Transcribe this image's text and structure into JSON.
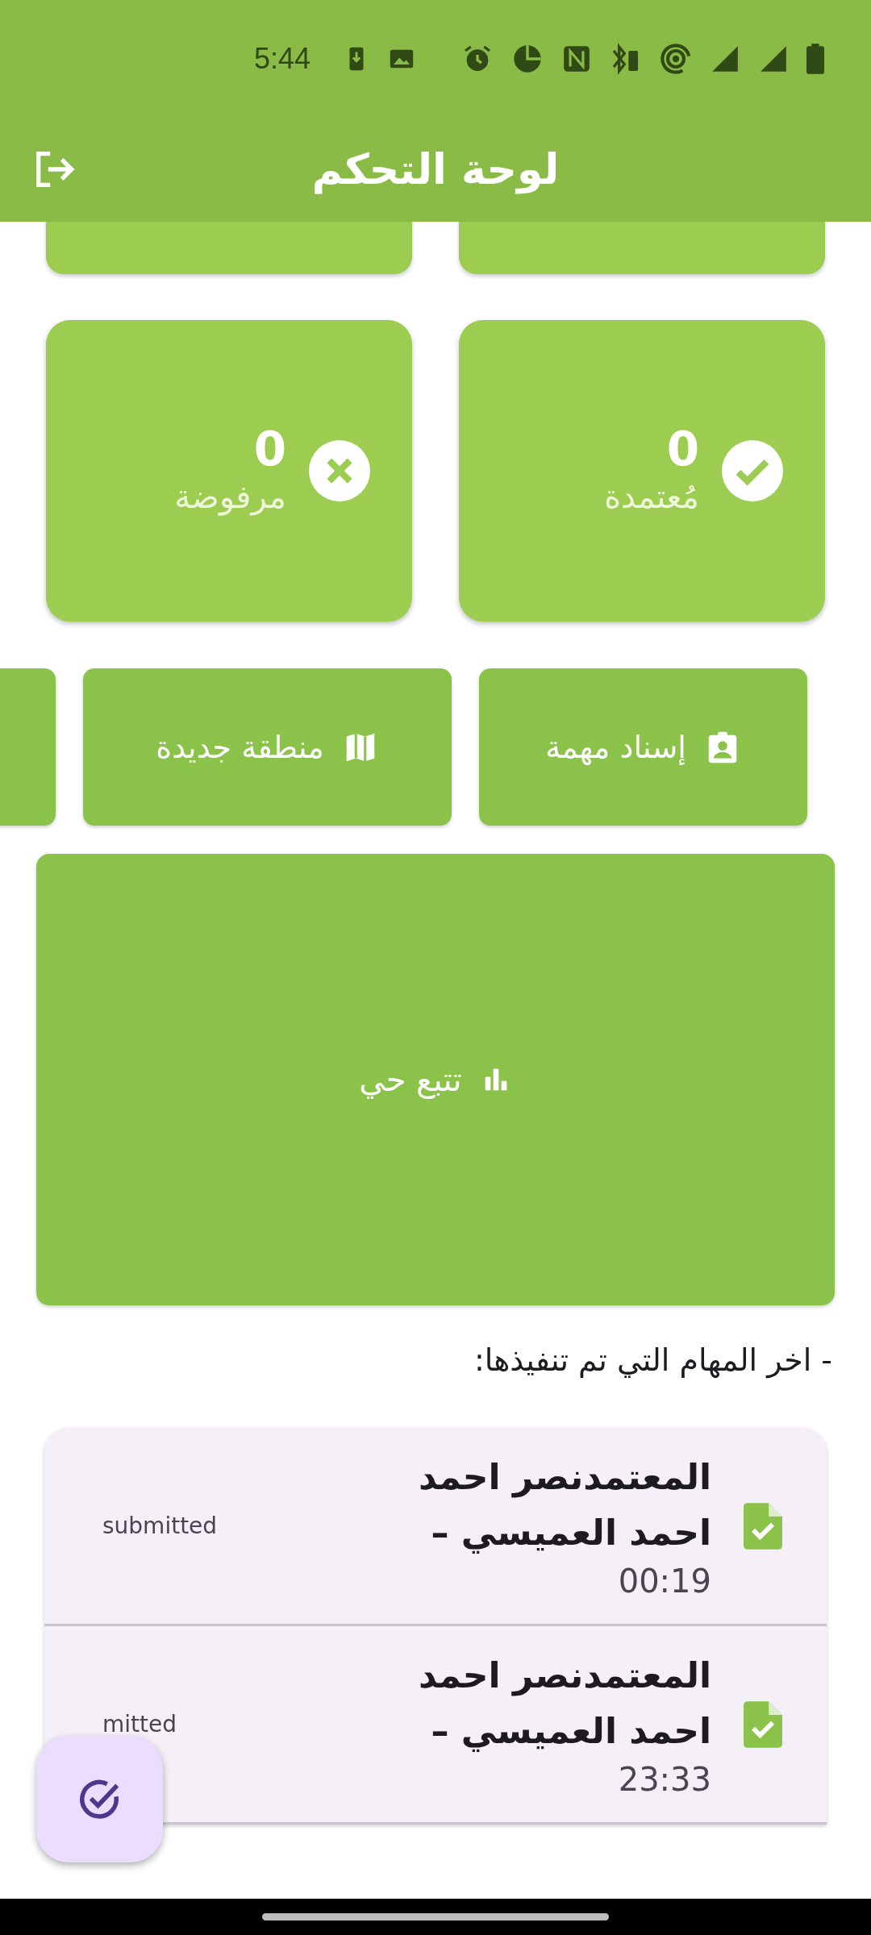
{
  "status_bar": {
    "time": "5:44"
  },
  "app_bar": {
    "title": "لوحة التحكم"
  },
  "stat_cards": [
    {
      "kind": "approved",
      "count": "0",
      "label": "مُعتمدة"
    },
    {
      "kind": "rejected",
      "count": "0",
      "label": "مرفوضة"
    }
  ],
  "actions": [
    {
      "kind": "assign",
      "label": "إسناد مهمة"
    },
    {
      "kind": "area",
      "label": "منطقة جديدة"
    },
    {
      "kind": "clipped"
    }
  ],
  "live_tracking": {
    "label": "تتبع حي"
  },
  "recent_heading": "- اخر المهام التي تم تنفيذها:",
  "recent_tasks": [
    {
      "title": "المعتمدنصر احمد احمد العميسي –",
      "time": "00:19",
      "status": "submitted"
    },
    {
      "title": "المعتمدنصر احمد احمد العميسي –",
      "time": "23:33",
      "status": "mitted"
    }
  ]
}
